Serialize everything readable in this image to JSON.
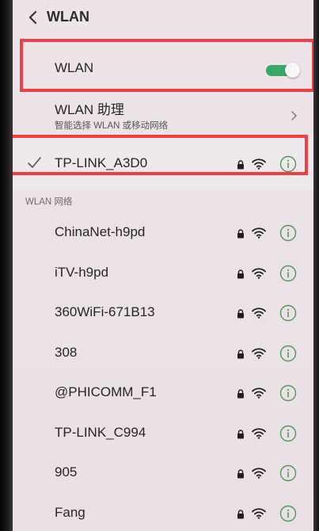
{
  "header": {
    "title": "WLAN"
  },
  "wlan_toggle": {
    "label": "WLAN",
    "state": "on"
  },
  "assistant": {
    "title": "WLAN 助理",
    "subtitle": "智能选择 WLAN 或移动网络"
  },
  "connected": {
    "ssid": "TP-LINK_A3D0"
  },
  "section": {
    "label": "WLAN 网络"
  },
  "networks": [
    {
      "ssid": "ChinaNet-h9pd"
    },
    {
      "ssid": "iTV-h9pd"
    },
    {
      "ssid": "360WiFi-671B13"
    },
    {
      "ssid": "308"
    },
    {
      "ssid": "@PHICOMM_F1"
    },
    {
      "ssid": "TP-LINK_C994"
    },
    {
      "ssid": "905"
    },
    {
      "ssid": "Fang"
    }
  ],
  "icons": {
    "back": "chevron-left-icon",
    "chevron": "chevron-right-icon",
    "check": "check-icon",
    "lock": "lock-icon",
    "wifi": "wifi-icon",
    "info": "info-icon"
  },
  "colors": {
    "toggle_on": "#37a865",
    "highlight": "#ef3f45",
    "accent_icon": "#4f9a58"
  }
}
